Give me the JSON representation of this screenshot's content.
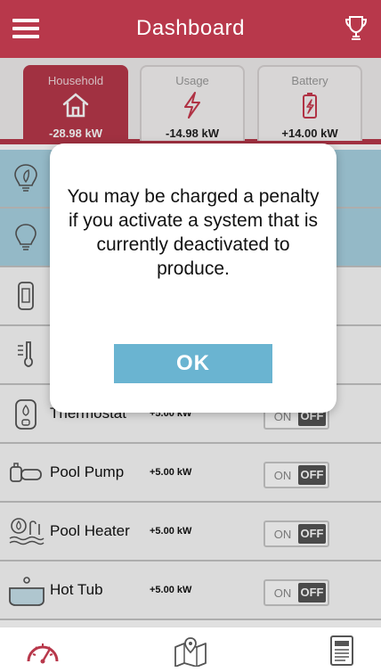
{
  "header": {
    "title": "Dashboard",
    "menu_icon": "hamburger-menu-icon",
    "trophy_icon": "trophy-icon"
  },
  "tabs": [
    {
      "name": "Household",
      "value": "-28.98 kW",
      "icon": "house-icon",
      "active": true
    },
    {
      "name": "Usage",
      "value": "-14.98 kW",
      "icon": "lightning-icon",
      "active": false
    },
    {
      "name": "Battery",
      "value": "+14.00 kW",
      "icon": "battery-icon",
      "active": false
    }
  ],
  "devices": [
    {
      "name": "",
      "kw": "",
      "icon": "bulb-leaf-icon",
      "highlight": true
    },
    {
      "name": "",
      "kw": "",
      "icon": "bulb-icon",
      "highlight": true
    },
    {
      "name": "",
      "kw": "",
      "icon": "phone-icon",
      "highlight": false
    },
    {
      "name": "",
      "kw": "",
      "icon": "thermometer-icon",
      "highlight": false
    },
    {
      "name": "Thermostat",
      "kw": "+5.00 kW",
      "icon": "thermostat-icon",
      "toggle_on": "ON",
      "toggle_off": "OFF"
    },
    {
      "name": "Pool Pump",
      "kw": "+5.00 kW",
      "icon": "pool-pump-icon",
      "toggle_on": "ON",
      "toggle_off": "OFF"
    },
    {
      "name": "Pool Heater",
      "kw": "+5.00 kW",
      "icon": "pool-heater-icon",
      "toggle_on": "ON",
      "toggle_off": "OFF"
    },
    {
      "name": "Hot Tub",
      "kw": "+5.00 kW",
      "icon": "hot-tub-icon",
      "toggle_on": "ON",
      "toggle_off": "OFF"
    }
  ],
  "modal": {
    "message": "You may be charged a penalty if you activate a system that is currently deactivated to produce.",
    "ok_label": "OK"
  },
  "bottom_nav": [
    {
      "icon": "speedometer-icon"
    },
    {
      "icon": "map-icon"
    },
    {
      "icon": "document-icon"
    }
  ],
  "colors": {
    "brand": "#b8384b",
    "highlight": "#a9d3e3",
    "ok_button": "#6ab4d1"
  }
}
